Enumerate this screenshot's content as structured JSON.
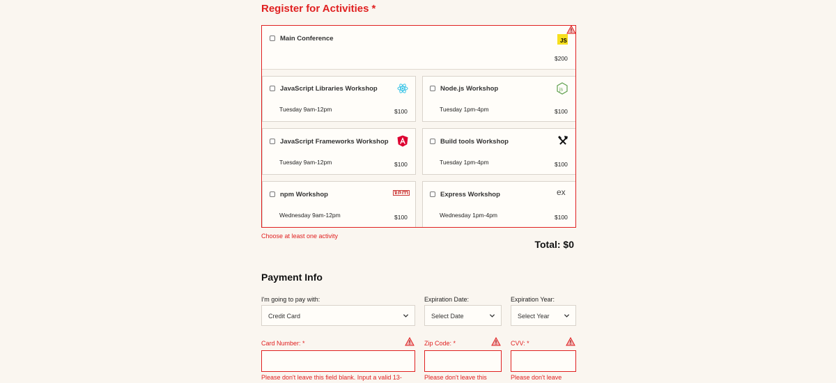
{
  "activities": {
    "title": "Register for Activities",
    "required_mark": "*",
    "main": {
      "label": "Main Conference",
      "price": "$200",
      "icon": "js-logo-icon"
    },
    "workshops": [
      {
        "label": "JavaScript Libraries Workshop",
        "time": "Tuesday 9am-12pm",
        "price": "$100",
        "icon": "react-icon"
      },
      {
        "label": "Node.js Workshop",
        "time": "Tuesday 1pm-4pm",
        "price": "$100",
        "icon": "nodejs-icon"
      },
      {
        "label": "JavaScript Frameworks Workshop",
        "time": "Tuesday 9am-12pm",
        "price": "$100",
        "icon": "angular-icon"
      },
      {
        "label": "Build tools Workshop",
        "time": "Tuesday 1pm-4pm",
        "price": "$100",
        "icon": "tools-icon"
      },
      {
        "label": "npm Workshop",
        "time": "Wednesday 9am-12pm",
        "price": "$100",
        "icon": "npm-icon"
      },
      {
        "label": "Express Workshop",
        "time": "Wednesday 1pm-4pm",
        "price": "$100",
        "icon": "express-icon"
      }
    ],
    "error": "Choose at least one activity",
    "total": "Total: $0"
  },
  "payment": {
    "title": "Payment Info",
    "method_label": "I'm going to pay with:",
    "method_value": "Credit Card",
    "exp_date_label": "Expiration Date:",
    "exp_date_value": "Select Date",
    "exp_year_label": "Expiration Year:",
    "exp_year_value": "Select Year",
    "card_label": "Card Number: *",
    "zip_label": "Zip Code: *",
    "cvv_label": "CVV: *",
    "card_error": "Please don't leave this field blank. Input a valid 13-",
    "zip_error": "Please don't leave this",
    "cvv_error": "Please don't leave"
  },
  "colors": {
    "accent": "#e02020",
    "background": "#faf6f0"
  }
}
